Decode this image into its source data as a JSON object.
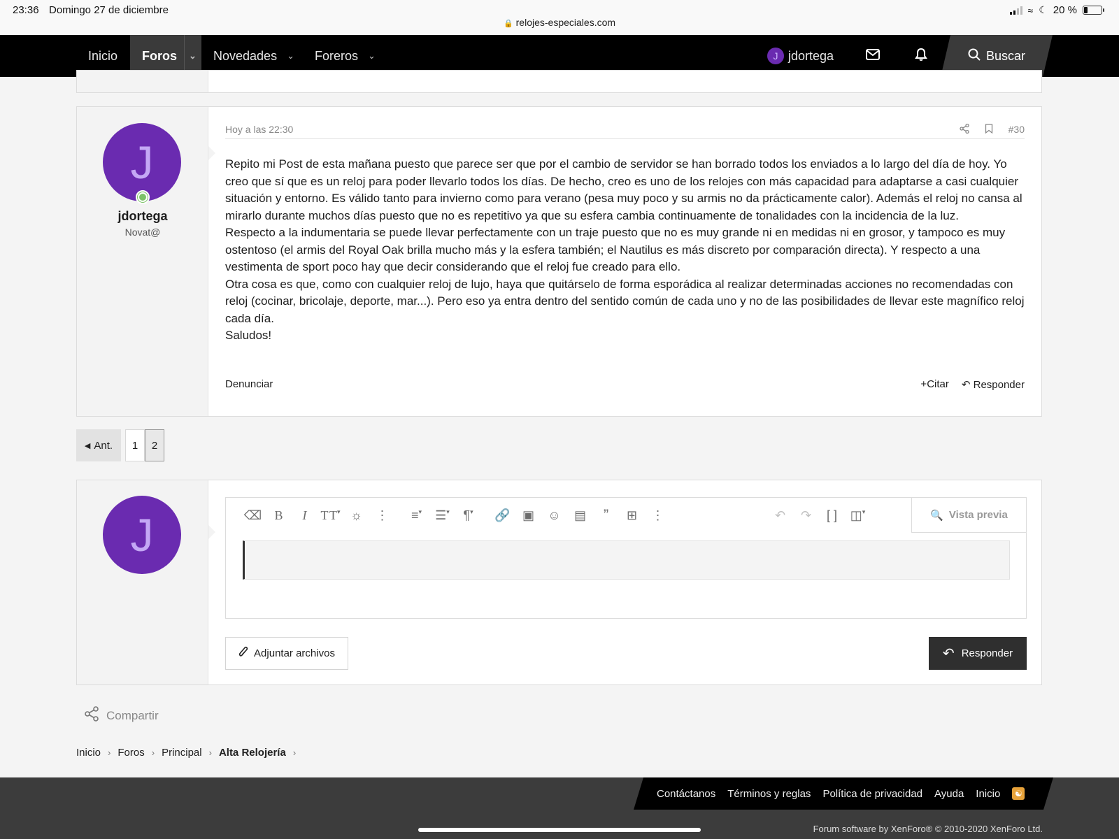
{
  "status_bar": {
    "time": "23:36",
    "date": "Domingo 27 de diciembre",
    "url": "relojes-especiales.com",
    "battery": "20 %",
    "battery_level": 0.2
  },
  "nav": {
    "items": [
      {
        "label": "Inicio"
      },
      {
        "label": "Foros"
      },
      {
        "label": "Novedades"
      },
      {
        "label": "Foreros"
      }
    ],
    "user": "jdortega",
    "user_initial": "J",
    "search_label": "Buscar"
  },
  "post": {
    "timestamp": "Hoy a las 22:30",
    "number": "#30",
    "author": "jdortega",
    "author_initial": "J",
    "author_title": "Novat@",
    "paragraphs": [
      "Repito mi Post de esta mañana puesto que parece ser que por el cambio de servidor se han borrado todos los enviados a lo largo del día de hoy. Yo creo que sí que es un reloj para poder llevarlo todos los días. De hecho, creo es uno de los relojes con más capacidad para adaptarse a casi cualquier situación y entorno. Es válido tanto para invierno como para verano (pesa muy poco y su armis no da prácticamente calor). Además el reloj no cansa al mirarlo durante muchos días puesto que no es repetitivo ya que su esfera cambia continuamente de tonalidades con la incidencia de la luz.",
      "Respecto a la indumentaria se puede llevar perfectamente con un traje puesto que no es muy grande ni en medidas ni en grosor, y tampoco es muy ostentoso (el armis del Royal Oak brilla mucho más y la esfera también; el Nautilus es más discreto por comparación directa). Y respecto a una vestimenta de sport poco hay que decir considerando que el reloj fue creado para ello.",
      "Otra cosa es que, como con cualquier reloj de lujo, haya que quitárselo de forma esporádica al realizar determinadas acciones no recomendadas con reloj (cocinar, bricolaje, deporte, mar...). Pero eso ya entra dentro del sentido común de cada uno y no de las posibilidades de llevar este magnífico reloj cada día.",
      "Saludos!"
    ],
    "report_label": "Denunciar",
    "quote_label": "Citar",
    "reply_label": "Responder"
  },
  "pagination": {
    "prev_label": "Ant.",
    "pages": [
      "1",
      "2"
    ],
    "current": "2"
  },
  "editor": {
    "user_initial": "J",
    "preview_label": "Vista previa",
    "attach_label": "Adjuntar archivos",
    "submit_label": "Responder",
    "toolbar_icons": [
      "eraser-icon",
      "bold-icon",
      "italic-icon",
      "text-size-icon",
      "palette-icon",
      "more-icon",
      "list-icon",
      "align-icon",
      "paragraph-icon",
      "link-icon",
      "image-icon",
      "smiley-icon",
      "media-icon",
      "quote-icon",
      "table-icon",
      "more-icon",
      "undo-icon",
      "redo-icon",
      "brackets-icon",
      "save-draft-icon"
    ]
  },
  "share_label": "Compartir",
  "breadcrumb": [
    "Inicio",
    "Foros",
    "Principal",
    "Alta Relojería"
  ],
  "footer": {
    "links": [
      "Contáctanos",
      "Términos y reglas",
      "Política de privacidad",
      "Ayuda",
      "Inicio"
    ],
    "copyright": "Forum software by XenForo® © 2010-2020 XenForo Ltd."
  },
  "colors": {
    "avatar": "#6a2bb0",
    "nav_bg": "#000000",
    "online": "#7cc268",
    "rss": "#e7a23a"
  }
}
